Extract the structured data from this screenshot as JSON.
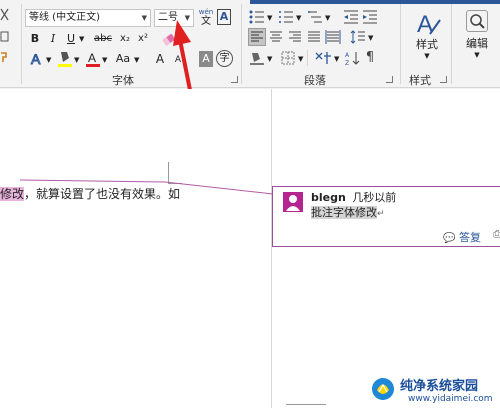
{
  "ribbon": {
    "font": {
      "font_name": "等线 (中文正文)",
      "font_size": "二号",
      "phonetic_guide": "wén",
      "bold": "B",
      "italic": "I",
      "underline": "U",
      "strikethrough": "abc",
      "subscript": "x₂",
      "superscript": "x²",
      "change_case": "Aa",
      "grow_font": "A",
      "shrink_font": "A",
      "char_shading": "A",
      "enclose_char": "字",
      "group_label": "字体"
    },
    "paragraph": {
      "group_label": "段落"
    },
    "styles": {
      "button_label": "样式",
      "group_label": "样式"
    },
    "editing": {
      "button_label": "编辑"
    }
  },
  "document": {
    "text_highlighted": "修改",
    "text_rest": "，就算设置了也没有效果。如"
  },
  "comment": {
    "author": "blegn",
    "time": "几秒以前",
    "text": "批注字体修改",
    "reply_label": "答复"
  },
  "watermark": {
    "title": "纯净系统家园",
    "url": "www.yidaimei.com"
  },
  "colors": {
    "accent_blue": "#2b579a",
    "comment_border": "#9b4f96",
    "avatar_color": "#b5258f",
    "highlight_pink": "#e8b4dc",
    "arrow_red": "#e02020"
  }
}
